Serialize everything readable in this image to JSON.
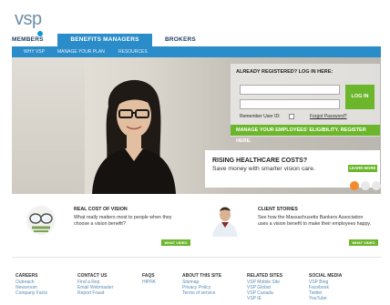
{
  "brand": {
    "logo_text": "vsp",
    "accent": "#2a8cc8",
    "green": "#6cb62c"
  },
  "nav": {
    "tabs": [
      {
        "label": "MEMBERS"
      },
      {
        "label": "BENEFITS MANAGERS"
      },
      {
        "label": "BROKERS"
      }
    ],
    "subtabs": [
      {
        "label": "WHY VSP"
      },
      {
        "label": "MANAGE YOUR PLAN"
      },
      {
        "label": "RESOURCES"
      }
    ]
  },
  "login": {
    "title": "ALREADY REGISTERED? LOG IN HERE:",
    "login_button": "LOG IN",
    "remember_label": "Remember User ID:",
    "forgot_label": "Forgot Password?",
    "green_bar": "MANAGE YOUR EMPLOYEES' ELIGIBILITY.   REGISTER HERE."
  },
  "promo": {
    "heading": "RISING HEALTHCARE COSTS?",
    "subtext": "Save money with smarter vision care.",
    "learn_more": "LEARN MORE"
  },
  "cards": [
    {
      "heading": "REAL COST OF VISION",
      "text": "What really matters most to people when they choose a vision benefit?",
      "button": "WHAT VIDEO"
    },
    {
      "heading": "CLIENT STORIES",
      "text": "See how the Massachusetts Bankers Association uses a vision benefit to make their employees happy.",
      "button": "WHAT VIDEO"
    }
  ],
  "footer": {
    "columns": [
      {
        "heading": "CAREERS",
        "links": [
          "Outreach",
          "Newsroom",
          "Company Facts"
        ]
      },
      {
        "heading": "CONTACT US",
        "links": [
          "Find a Rep",
          "Email Webmaster",
          "Report Fraud"
        ]
      },
      {
        "heading": "FAQS",
        "links": [
          "HIPPA"
        ]
      },
      {
        "heading": "ABOUT THIS SITE",
        "links": [
          "Sitemap",
          "Privacy Policy",
          "Terms of service"
        ]
      },
      {
        "heading": "RELATED SITES",
        "links": [
          "VSP Mobile Site",
          "VSP Global",
          "VSP Canada",
          "VSP IE"
        ]
      },
      {
        "heading": "SOCIAL MEDIA",
        "links": [
          "VSP Blog",
          "Facebook",
          "Twitter",
          "YouTube"
        ]
      }
    ]
  }
}
